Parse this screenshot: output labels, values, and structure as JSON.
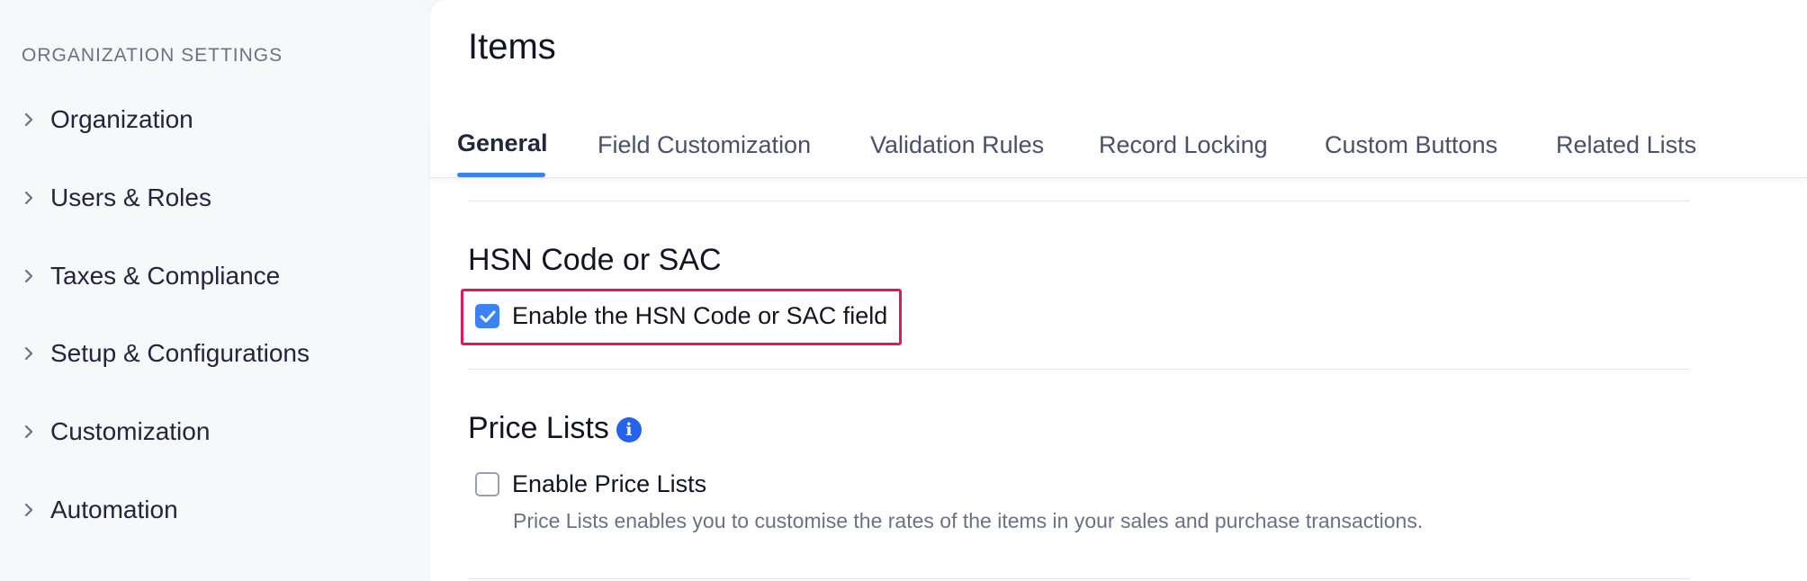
{
  "sidebar": {
    "heading": "ORGANIZATION SETTINGS",
    "items": [
      {
        "label": "Organization"
      },
      {
        "label": "Users & Roles"
      },
      {
        "label": "Taxes & Compliance"
      },
      {
        "label": "Setup & Configurations"
      },
      {
        "label": "Customization"
      },
      {
        "label": "Automation"
      }
    ]
  },
  "main": {
    "title": "Items",
    "tabs": [
      {
        "label": "General",
        "active": true
      },
      {
        "label": "Field Customization"
      },
      {
        "label": "Validation Rules"
      },
      {
        "label": "Record Locking"
      },
      {
        "label": "Custom Buttons"
      },
      {
        "label": "Related Lists"
      }
    ],
    "sections": {
      "hsn": {
        "title": "HSN Code or SAC",
        "checkbox_label": "Enable the HSN Code or SAC field",
        "checked": true
      },
      "price_lists": {
        "title": "Price Lists",
        "info_icon": "info-icon",
        "checkbox_label": "Enable Price Lists",
        "checked": false,
        "helper": "Price Lists enables you to customise the rates of the items in your sales and purchase transactions."
      }
    }
  },
  "colors": {
    "accent": "#3b82f6",
    "highlight": "#e0185a",
    "info": "#2563eb"
  }
}
